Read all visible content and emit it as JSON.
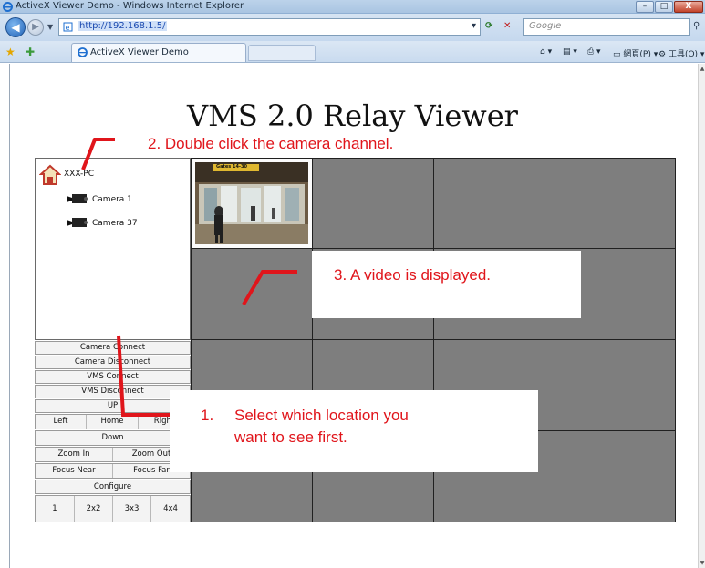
{
  "browser": {
    "window_title": "ActiveX Viewer Demo - Windows Internet Explorer",
    "url": "http://192.168.1.5/",
    "search_placeholder": "Google",
    "tab_label": "ActiveX Viewer Demo",
    "command_page": "網頁(P)",
    "command_tools": "工具(O)",
    "window_buttons": {
      "minimize": "–",
      "maximize": "□",
      "close": "X"
    }
  },
  "page": {
    "heading": "VMS 2.0 Relay Viewer"
  },
  "tree": {
    "root_label": "XXX-PC",
    "cameras": [
      "Camera 1",
      "Camera 37"
    ]
  },
  "controls": {
    "camera_connect": "Camera Connect",
    "camera_disconnect": "Camera Disconnect",
    "vms_connect": "VMS Connect",
    "vms_disconnect": "VMS Disconnect",
    "up": "UP",
    "left": "Left",
    "home": "Home",
    "right": "Right",
    "down": "Down",
    "zoom_in": "Zoom In",
    "zoom_out": "Zoom Out",
    "focus_near": "Focus Near",
    "focus_far": "Focus Far",
    "configure": "Configure",
    "layouts": [
      "1",
      "2x2",
      "3x3",
      "4x4"
    ]
  },
  "video": {
    "overlay_text": "Gates 14-30"
  },
  "annotations": {
    "step1_number": "1.",
    "step1_line1": "Select which location you",
    "step1_line2": "want to see first.",
    "step2": "2. Double click the camera channel.",
    "step3": "3. A video is displayed.",
    "color": "#e0151b"
  }
}
